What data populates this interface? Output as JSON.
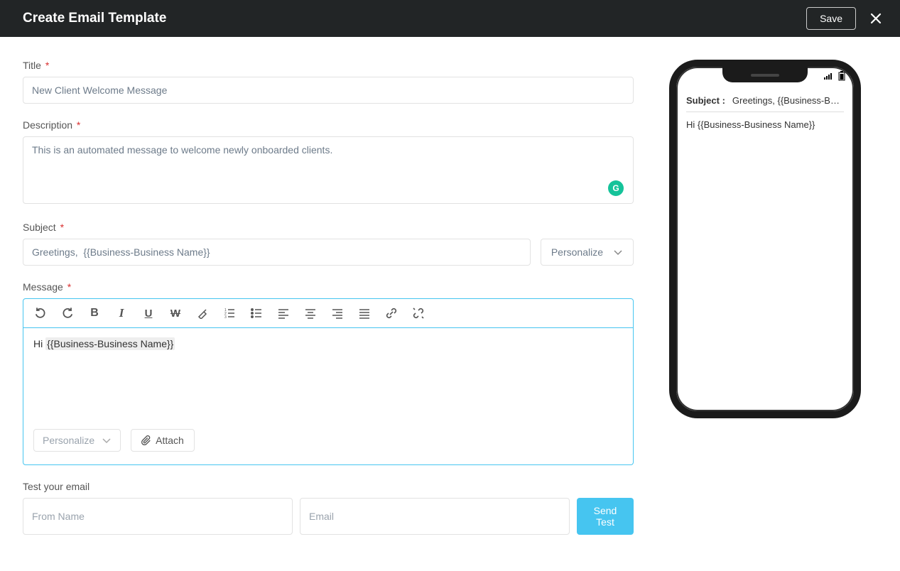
{
  "header": {
    "title": "Create Email Template",
    "save_label": "Save"
  },
  "labels": {
    "title": "Title",
    "description": "Description",
    "subject": "Subject",
    "message": "Message",
    "test": "Test your email"
  },
  "fields": {
    "title_value": "New Client Welcome Message",
    "description_value": "This is an automated message to welcome newly onboarded clients.",
    "subject_value": "Greetings,  {{Business-Business Name}}",
    "from_name_placeholder": "From Name",
    "email_placeholder": "Email"
  },
  "controls": {
    "personalize_label": "Personalize",
    "attach_label": "Attach",
    "send_test_label": "Send Test"
  },
  "editor": {
    "body_prefix": "Hi ",
    "body_token": "{{Business-Business Name}}"
  },
  "preview": {
    "subject_label": "Subject :",
    "subject_value": "Greetings, {{Business-Busines…",
    "body": "Hi {{Business-Business Name}}"
  }
}
